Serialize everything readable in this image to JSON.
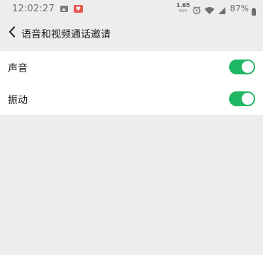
{
  "status_bar": {
    "time": "12:02:27",
    "net_speed_value": "1.65",
    "net_speed_unit": "KB/S",
    "battery": "87%",
    "icons": [
      "image-icon",
      "notification-app-icon",
      "alarm-icon",
      "wifi-icon",
      "signal-icon",
      "battery-icon"
    ]
  },
  "header": {
    "title": "语音和视频通话邀请"
  },
  "settings": {
    "items": [
      {
        "label": "声音",
        "enabled": true
      },
      {
        "label": "振动",
        "enabled": true
      }
    ]
  },
  "colors": {
    "background": "#ededed",
    "card": "#ffffff",
    "toggle_on": "#20b764"
  }
}
